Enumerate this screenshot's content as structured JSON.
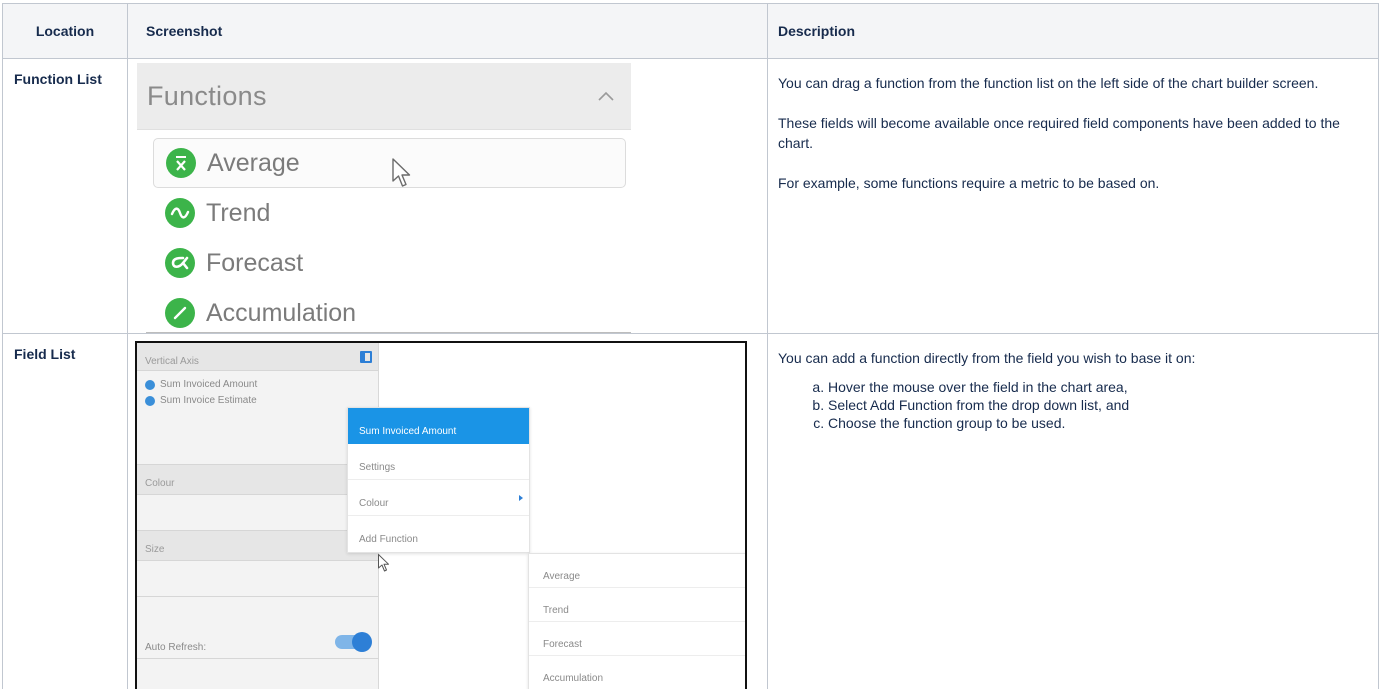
{
  "table": {
    "headers": {
      "location": "Location",
      "screenshot": "Screenshot",
      "description": "Description"
    },
    "rows": [
      {
        "location": "Function List",
        "functions_panel": {
          "title": "Functions",
          "items": [
            "Average",
            "Trend",
            "Forecast",
            "Accumulation"
          ],
          "hovered_item": "Average"
        },
        "description": [
          "You can drag a function from the function list on the left side of the chart builder screen.",
          "These fields will become available once required field components have been added to the chart.",
          "For example, some functions require a metric to be based on."
        ]
      },
      {
        "location": "Field List",
        "field_panel": {
          "vertical_axis_label": "Vertical Axis",
          "fields": [
            "Sum Invoiced Amount",
            "Sum Invoice Estimate"
          ],
          "colour_label": "Colour",
          "size_label": "Size",
          "auto_refresh_label": "Auto Refresh:",
          "context_menu": [
            "Sum Invoiced Amount",
            "Settings",
            "Colour",
            "Add Function"
          ],
          "function_submenu": [
            "Average",
            "Trend",
            "Forecast",
            "Accumulation"
          ]
        },
        "description": {
          "intro": "You can add a function directly from the field you wish to base it on:",
          "steps": [
            "Hover the mouse over the field in the chart area,",
            "Select Add Function from the drop down list, and",
            "Choose the function group to be used."
          ]
        }
      }
    ]
  },
  "colors": {
    "function_icon_green": "#3cb44a",
    "menu_selected_blue": "#1a94e6",
    "header_bg": "#f4f5f7",
    "border": "#c1c7d0"
  },
  "icons": [
    "chevron-up-icon",
    "average-icon",
    "trend-icon",
    "forecast-icon",
    "accumulation-icon",
    "mouse-pointer-icon"
  ]
}
